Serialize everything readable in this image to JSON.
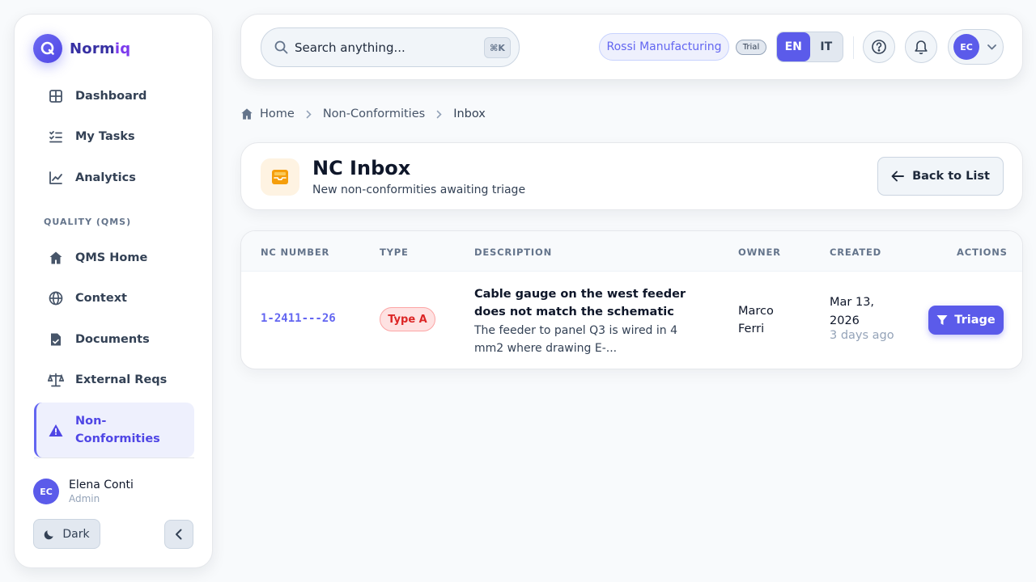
{
  "brand": {
    "name_part1": "Norm",
    "name_part2": "iq",
    "logo_letter": "Q"
  },
  "sidebar": {
    "items": [
      {
        "label": "Dashboard",
        "icon": "dashboard-icon"
      },
      {
        "label": "My Tasks",
        "icon": "tasks-icon"
      },
      {
        "label": "Analytics",
        "icon": "analytics-icon"
      },
      {
        "label": "QMS Home",
        "icon": "home-icon"
      },
      {
        "label": "Context",
        "icon": "globe-icon"
      },
      {
        "label": "Documents",
        "icon": "document-icon"
      },
      {
        "label": "External Reqs",
        "icon": "scale-icon"
      },
      {
        "label": "Non-Conformities",
        "icon": "warning-icon",
        "active": true
      }
    ],
    "section_label": "QUALITY (QMS)",
    "user": {
      "initials": "EC",
      "name": "Elena Conti",
      "role": "Admin"
    },
    "dark_label": "Dark"
  },
  "topbar": {
    "search_placeholder": "Search anything...",
    "shortcut": "⌘K",
    "organization": "Rossi Manufacturing",
    "plan_badge": "Trial",
    "languages": [
      "EN",
      "IT"
    ],
    "active_language": "EN",
    "user_initials": "EC"
  },
  "breadcrumb": {
    "home": "Home",
    "section": "Non-Conformities",
    "current": "Inbox"
  },
  "header": {
    "title": "NC Inbox",
    "subtitle": "New non-conformities awaiting triage",
    "back_label": "Back to List"
  },
  "table": {
    "columns": [
      "NC NUMBER",
      "TYPE",
      "DESCRIPTION",
      "OWNER",
      "CREATED",
      "ACTIONS"
    ],
    "rows": [
      {
        "nc_number": "1-2411---26",
        "type": "Type A",
        "desc_title": "Cable gauge on the west feeder does not match the schematic",
        "desc_text": "The feeder to panel Q3 is wired in 4 mm2 where drawing E-...",
        "owner": "Marco Ferri",
        "created": "Mar 13, 2026",
        "created_relative": "3 days ago",
        "action": "Triage"
      }
    ]
  },
  "colors": {
    "accent": "#5b5bea",
    "brand_text": "#3730a3",
    "danger": "#dc2626",
    "inbox_icon": "#f59e0b"
  }
}
